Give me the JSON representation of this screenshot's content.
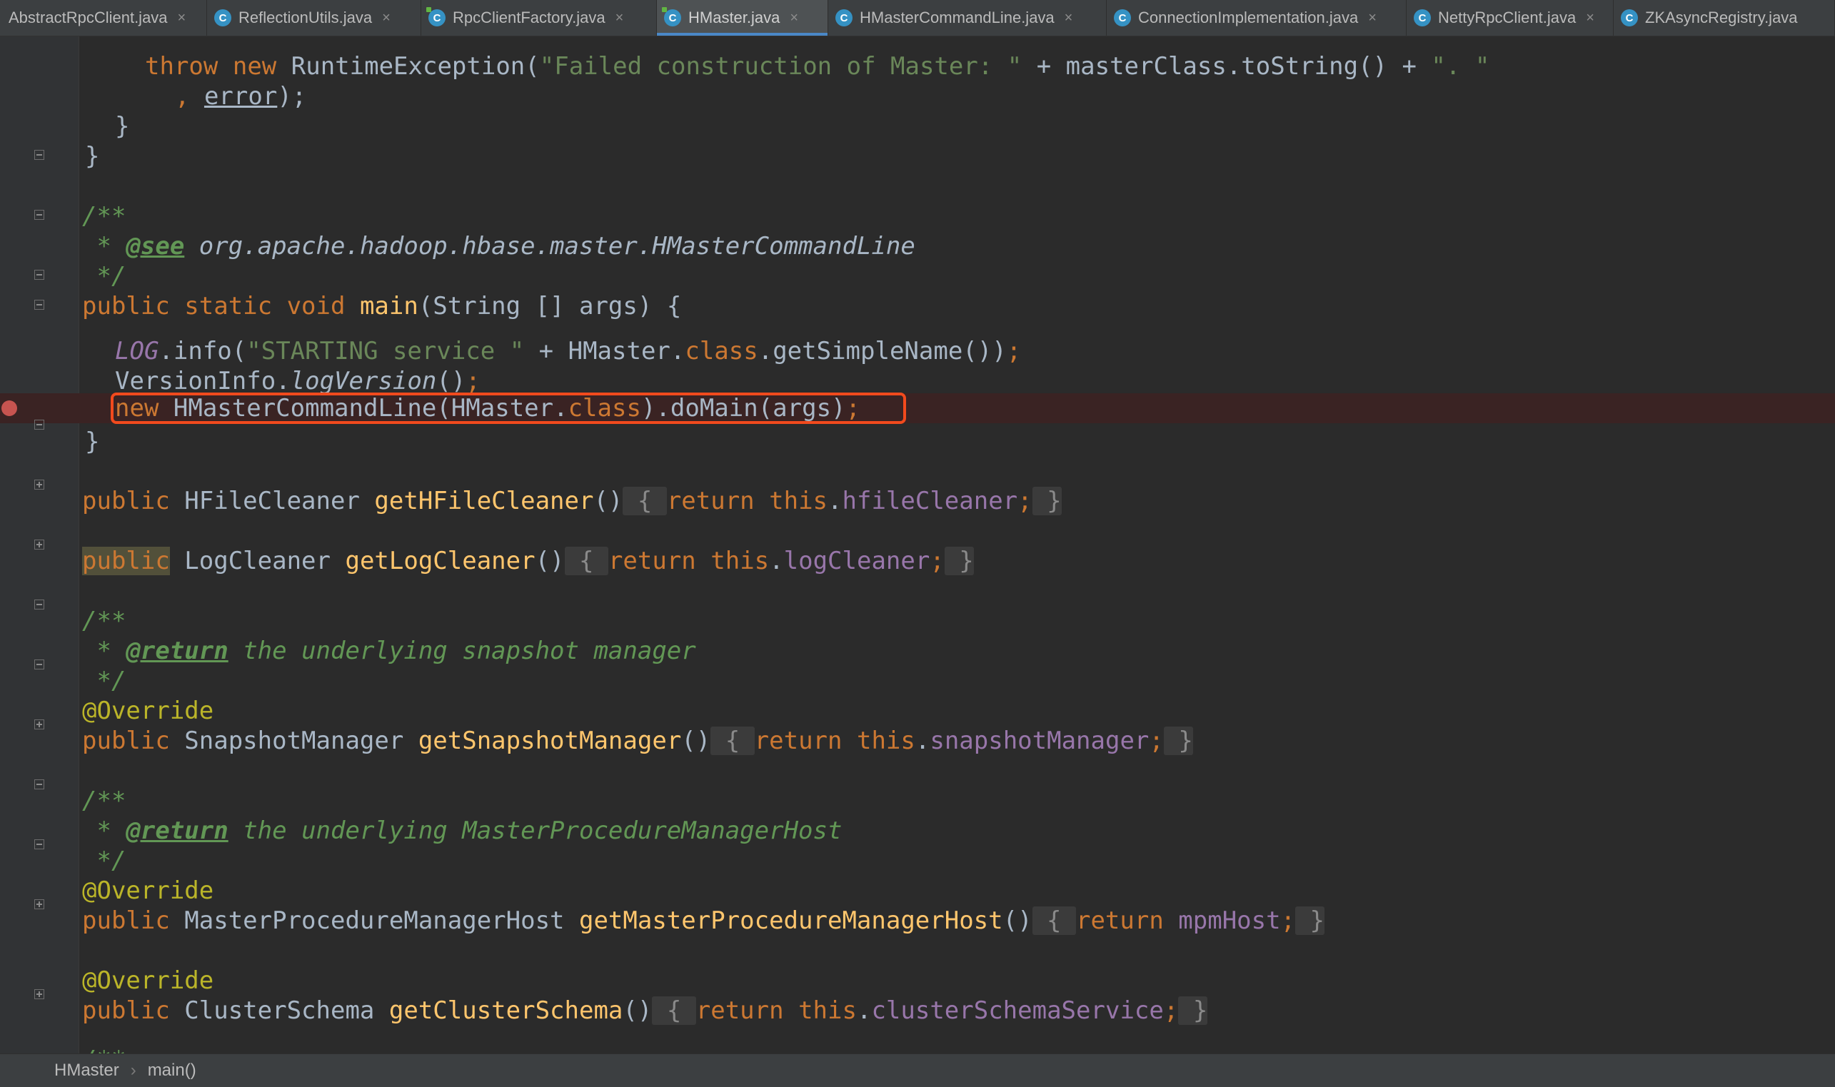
{
  "tabs": [
    {
      "label": "AbstractRpcClient.java",
      "icon": "",
      "active": false
    },
    {
      "label": "ReflectionUtils.java",
      "icon": "class-icon",
      "active": false
    },
    {
      "label": "RpcClientFactory.java",
      "icon": "class-icon",
      "active": false
    },
    {
      "label": "HMaster.java",
      "icon": "class-icon",
      "active": true
    },
    {
      "label": "HMasterCommandLine.java",
      "icon": "class-icon",
      "active": false
    },
    {
      "label": "ConnectionImplementation.java",
      "icon": "class-icon",
      "active": false
    },
    {
      "label": "NettyRpcClient.java",
      "icon": "class-icon",
      "active": false
    },
    {
      "label": "ZKAsyncRegistry.java",
      "icon": "class-icon",
      "active": false
    }
  ],
  "tab_close_glyph": "×",
  "class_icon_letter": "C",
  "code": {
    "l1": {
      "kw_throw": "throw",
      "kw_new": "new",
      "cls": "RuntimeException",
      "paren": "(",
      "str1": "\"Failed construction of Master: \"",
      "plus": " + masterClass.toString() + ",
      "str2": "\". \""
    },
    "l2": {
      "comma": ", ",
      "var": "error",
      "end": ");"
    },
    "l3": {
      "brace": "}"
    },
    "l4": {
      "brace": "}"
    },
    "l5": {
      "open": "/**"
    },
    "l6": {
      "star": " * ",
      "tag": "@see",
      "ref": " org.apache.hadoop.hbase.master.HMasterCommandLine"
    },
    "l7": {
      "close": " */"
    },
    "l8": {
      "kw": "public static void ",
      "fn": "main",
      "rest": "(String [] args) {"
    },
    "l9": {
      "log": "LOG",
      "info": ".info(",
      "str": "\"STARTING service \"",
      "rest": " + HMaster.",
      "kw_class": "class",
      "rest2": ".getSimpleName())",
      "semi": ";"
    },
    "l10": {
      "cls": "VersionInfo.",
      "method": "logVersion",
      "rest": "()",
      "semi": ";"
    },
    "l11": {
      "kw_new": "new",
      "rest": " HMasterCommandLine(HMaster.",
      "kw_class": "class",
      "rest2": ").doMain(args)",
      "semi": ";"
    },
    "l12": {
      "brace": "}"
    },
    "l13": {
      "kw": "public",
      "type": " HFileCleaner ",
      "fn": "getHFileCleaner",
      "parens": "()",
      "ob": " { ",
      "kw_ret": "return",
      "kw_this": "this",
      "dot": ".",
      "fld": "hfileCleaner",
      "semi": ";",
      "cb": " }"
    },
    "l14": {
      "kw": "public",
      "type": " LogCleaner ",
      "fn": "getLogCleaner",
      "parens": "()",
      "ob": " { ",
      "kw_ret": "return",
      "kw_this": "this",
      "dot": ".",
      "fld": "logCleaner",
      "semi": ";",
      "cb": " }"
    },
    "l15": {
      "open": "/**"
    },
    "l16": {
      "star": " * ",
      "tag": "@return",
      "desc": " the underlying snapshot manager"
    },
    "l17": {
      "close": " */"
    },
    "l18": {
      "ann": "@Override"
    },
    "l19": {
      "kw": "public",
      "type": " SnapshotManager ",
      "fn": "getSnapshotManager",
      "parens": "()",
      "ob": " { ",
      "kw_ret": "return",
      "kw_this": "this",
      "dot": ".",
      "fld": "snapshotManager",
      "semi": ";",
      "cb": " }"
    },
    "l20": {
      "open": "/**"
    },
    "l21": {
      "star": " * ",
      "tag": "@return",
      "desc": " the underlying MasterProcedureManagerHost"
    },
    "l22": {
      "close": " */"
    },
    "l23": {
      "ann": "@Override"
    },
    "l24": {
      "kw": "public",
      "type": " MasterProcedureManagerHost ",
      "fn": "getMasterProcedureManagerHost",
      "parens": "()",
      "ob": " { ",
      "kw_ret": "return",
      "fld": "mpmHost",
      "semi": ";",
      "cb": " }"
    },
    "l25": {
      "ann": "@Override"
    },
    "l26": {
      "kw": "public",
      "type": " ClusterSchema ",
      "fn": "getClusterSchema",
      "parens": "()",
      "ob": " { ",
      "kw_ret": "return",
      "kw_this": "this",
      "dot": ".",
      "fld": "clusterSchemaService",
      "semi": ";",
      "cb": " }"
    },
    "l27": {
      "open": "/**"
    }
  },
  "breadcrumb": {
    "class": "HMaster",
    "separator": "›",
    "method": "main()"
  },
  "colors": {
    "keyword": "#cc7832",
    "string": "#6a8759",
    "method": "#ffc66d",
    "field": "#9876aa",
    "annotation": "#bbb529",
    "doc": "#629755",
    "highlight_box": "#f24a1d",
    "breakpoint": "#c75450"
  }
}
